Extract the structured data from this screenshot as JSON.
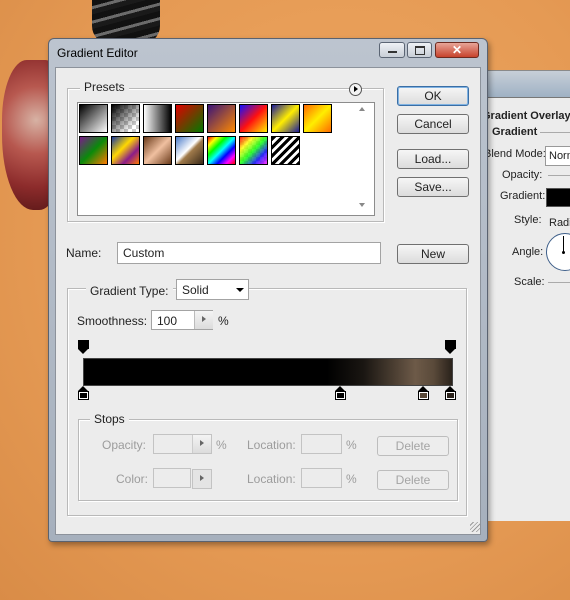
{
  "window": {
    "title": "Gradient Editor"
  },
  "presets": {
    "label": "Presets",
    "swatch_icons": [
      "black-white",
      "transparent-checker",
      "white-black-fade",
      "red-green",
      "violet-orange",
      "blue-red-yellow",
      "blue-yellow-blue",
      "orange-yellow-orange",
      "violet-green-orange",
      "yellow-violet-orange-blue",
      "copper",
      "chrome",
      "spectrum",
      "transparent-rainbow",
      "transparent-stripes"
    ]
  },
  "buttons": {
    "ok": "OK",
    "cancel": "Cancel",
    "load": "Load...",
    "save": "Save...",
    "new": "New"
  },
  "name": {
    "label": "Name:",
    "value": "Custom"
  },
  "gradient_type": {
    "label": "Gradient Type:",
    "value": "Solid"
  },
  "smoothness": {
    "label": "Smoothness:",
    "value": "100",
    "unit": "%"
  },
  "gradient": {
    "colors": [
      "#000000",
      "#000000",
      "#1a1612",
      "#6d5a48",
      "#2a221b"
    ],
    "color_stop_colors": [
      "#000000",
      "#000000",
      "#5a4a3a",
      "#2a221b"
    ],
    "opacity_stop_count": 2
  },
  "stops": {
    "label": "Stops",
    "opacity_label": "Opacity:",
    "opacity_unit": "%",
    "location_label": "Location:",
    "location_unit": "%",
    "color_label": "Color:",
    "delete_label": "Delete"
  },
  "layer_style": {
    "title_fragment": "Gradient Overlay",
    "section": "Gradient",
    "blend_mode_label": "Blend Mode:",
    "blend_mode_value": "Norm",
    "opacity_label": "Opacity:",
    "gradient_label": "Gradient:",
    "style_label": "Style:",
    "style_value": "Radia",
    "angle_label": "Angle:",
    "scale_label": "Scale:"
  }
}
